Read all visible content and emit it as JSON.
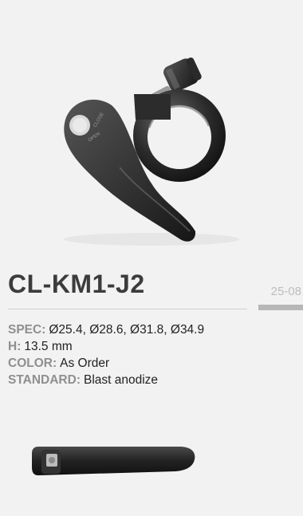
{
  "product": {
    "model": "CL-KM1-J2",
    "code": "25-08"
  },
  "specs": [
    {
      "key": "SPEC:",
      "value": "Ø25.4, Ø28.6, Ø31.8, Ø34.9"
    },
    {
      "key": "H:",
      "value": "13.5 mm"
    },
    {
      "key": "COLOR:",
      "value": "As Order"
    },
    {
      "key": "STANDARD:",
      "value": "Blast anodize"
    }
  ],
  "colors": {
    "background": "#f2f2f2",
    "title": "#3c3c3c",
    "label": "#8f8f8f",
    "code": "#bdbdbd"
  }
}
